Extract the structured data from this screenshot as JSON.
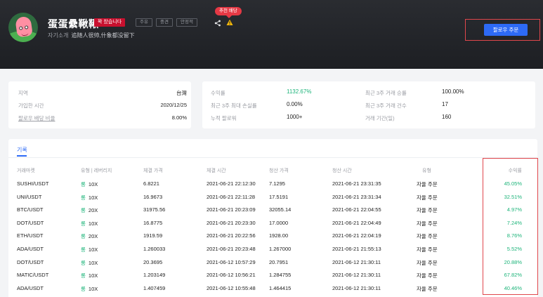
{
  "header": {
    "nickname": "蛋蛋纍鞦鞦",
    "full_badge": "꽉 찼습니다",
    "tags": [
      "주유",
      "중견",
      "안정적"
    ],
    "intro_label": "자기소개",
    "intro_value": "追随人很帅,什象都没留下",
    "recommended": "추천 배당",
    "follow_button": "팔로우 주문"
  },
  "profile": {
    "region_label": "지역",
    "region_value": "台灣",
    "joined_label": "가입한 시간",
    "joined_value": "2020/12/25",
    "dividend_label": "팔로우 배당 비율",
    "dividend_value": "8.00%"
  },
  "stats": {
    "yield_label": "수익률",
    "yield_value": "1132.67%",
    "winrate_label": "최근 3주 거래 승률",
    "winrate_value": "100.00%",
    "drawdown_label": "최근 3주 최대 손실률",
    "drawdown_value": "0.00%",
    "trades_label": "최근 3주 거래 건수",
    "trades_value": "17",
    "followers_label": "누적 팔로워",
    "followers_value": "1000+",
    "period_label": "거래 기간(일)",
    "period_value": "160"
  },
  "records": {
    "tab": "기록",
    "columns": [
      "거래마켓",
      "유형 | 레버리지",
      "체결 가격",
      "체결 시간",
      "청산 가격",
      "청산 시간",
      "유형",
      "수익률"
    ],
    "rows": [
      {
        "market": "SUSHI/USDT",
        "dir": "롱",
        "lev": "10X",
        "entry": "6.8221",
        "entry_time": "2021-06-21 22:12:30",
        "exit": "7.1295",
        "exit_time": "2021-06-21 23:31:35",
        "type": "자율 주문",
        "pnl": "45.05%"
      },
      {
        "market": "UNI/USDT",
        "dir": "롱",
        "lev": "10X",
        "entry": "16.9673",
        "entry_time": "2021-06-21 22:11:28",
        "exit": "17.5191",
        "exit_time": "2021-06-21 23:31:34",
        "type": "자율 주문",
        "pnl": "32.51%"
      },
      {
        "market": "BTC/USDT",
        "dir": "롱",
        "lev": "20X",
        "entry": "31975.56",
        "entry_time": "2021-06-21 20:23:09",
        "exit": "32055.14",
        "exit_time": "2021-06-21 22:04:55",
        "type": "자율 주문",
        "pnl": "4.97%"
      },
      {
        "market": "DOT/USDT",
        "dir": "롱",
        "lev": "10X",
        "entry": "16.8775",
        "entry_time": "2021-06-21 20:23:30",
        "exit": "17.0000",
        "exit_time": "2021-06-21 22:04:49",
        "type": "자율 주문",
        "pnl": "7.24%"
      },
      {
        "market": "ETH/USDT",
        "dir": "롱",
        "lev": "20X",
        "entry": "1919.59",
        "entry_time": "2021-06-21 20:22:56",
        "exit": "1928.00",
        "exit_time": "2021-06-21 22:04:19",
        "type": "자율 주문",
        "pnl": "8.76%"
      },
      {
        "market": "ADA/USDT",
        "dir": "롱",
        "lev": "10X",
        "entry": "1.260033",
        "entry_time": "2021-06-21 20:23:48",
        "exit": "1.267000",
        "exit_time": "2021-06-21 21:55:13",
        "type": "자율 주문",
        "pnl": "5.52%"
      },
      {
        "market": "DOT/USDT",
        "dir": "롱",
        "lev": "10X",
        "entry": "20.3695",
        "entry_time": "2021-06-12 10:57:29",
        "exit": "20.7951",
        "exit_time": "2021-06-12 21:30:11",
        "type": "자율 주문",
        "pnl": "20.88%"
      },
      {
        "market": "MATIC/USDT",
        "dir": "롱",
        "lev": "10X",
        "entry": "1.203149",
        "entry_time": "2021-06-12 10:56:21",
        "exit": "1.284755",
        "exit_time": "2021-06-12 21:30:11",
        "type": "자율 주문",
        "pnl": "67.82%"
      },
      {
        "market": "ADA/USDT",
        "dir": "롱",
        "lev": "10X",
        "entry": "1.407459",
        "entry_time": "2021-06-12 10:55:48",
        "exit": "1.464415",
        "exit_time": "2021-06-12 21:30:11",
        "type": "자율 주문",
        "pnl": "40.46%"
      }
    ]
  },
  "colors": {
    "accent": "#2d6af6",
    "positive": "#1db47a",
    "highlight_frame": "#e0474c",
    "badge_red": "#c8102e"
  }
}
